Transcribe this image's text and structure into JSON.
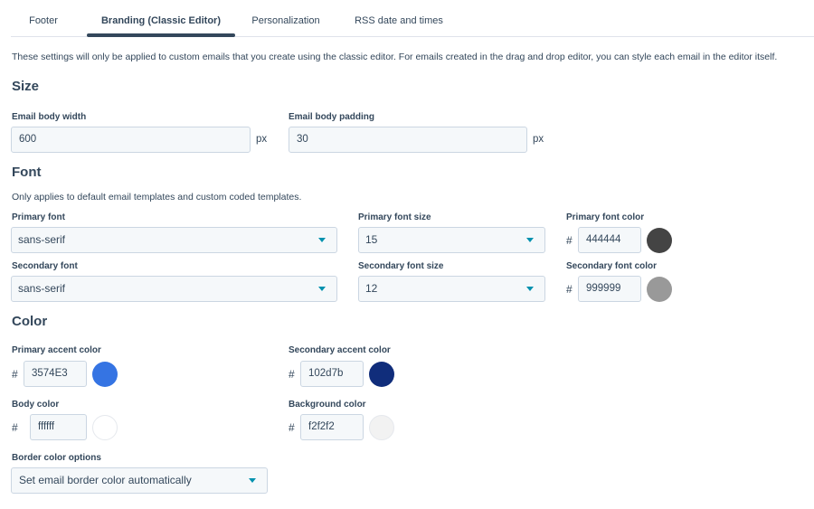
{
  "tabs": [
    {
      "label": "Footer",
      "active": false
    },
    {
      "label": "Branding (Classic Editor)",
      "active": true
    },
    {
      "label": "Personalization",
      "active": false
    },
    {
      "label": "RSS date and times",
      "active": false
    }
  ],
  "intro_note": "These settings will only be applied to custom emails that you create using the classic editor. For emails created in the drag and drop editor, you can style each email in the editor itself.",
  "size": {
    "heading": "Size",
    "body_width_label": "Email body width",
    "body_width_value": "600",
    "body_width_unit": "px",
    "body_padding_label": "Email body padding",
    "body_padding_value": "30",
    "body_padding_unit": "px"
  },
  "font": {
    "heading": "Font",
    "note": "Only applies to default email templates and custom coded templates.",
    "primary_font_label": "Primary font",
    "primary_font_value": "sans-serif",
    "primary_size_label": "Primary font size",
    "primary_size_value": "15",
    "primary_color_label": "Primary font color",
    "primary_color_value": "444444",
    "secondary_font_label": "Secondary font",
    "secondary_font_value": "sans-serif",
    "secondary_size_label": "Secondary font size",
    "secondary_size_value": "12",
    "secondary_color_label": "Secondary font color",
    "secondary_color_value": "999999"
  },
  "color": {
    "heading": "Color",
    "primary_accent_label": "Primary accent color",
    "primary_accent_value": "3574E3",
    "secondary_accent_label": "Secondary accent color",
    "secondary_accent_value": "102d7b",
    "body_label": "Body color",
    "body_value": "ffffff",
    "background_label": "Background color",
    "background_value": "f2f2f2",
    "border_options_label": "Border color options",
    "border_options_value": "Set email border color automatically"
  },
  "hash_symbol": "#",
  "swatch_colors": {
    "primary_font": "#444444",
    "secondary_font": "#999999",
    "primary_accent": "#3574E3",
    "secondary_accent": "#102d7b",
    "body": "#ffffff",
    "background": "#f2f2f2"
  }
}
